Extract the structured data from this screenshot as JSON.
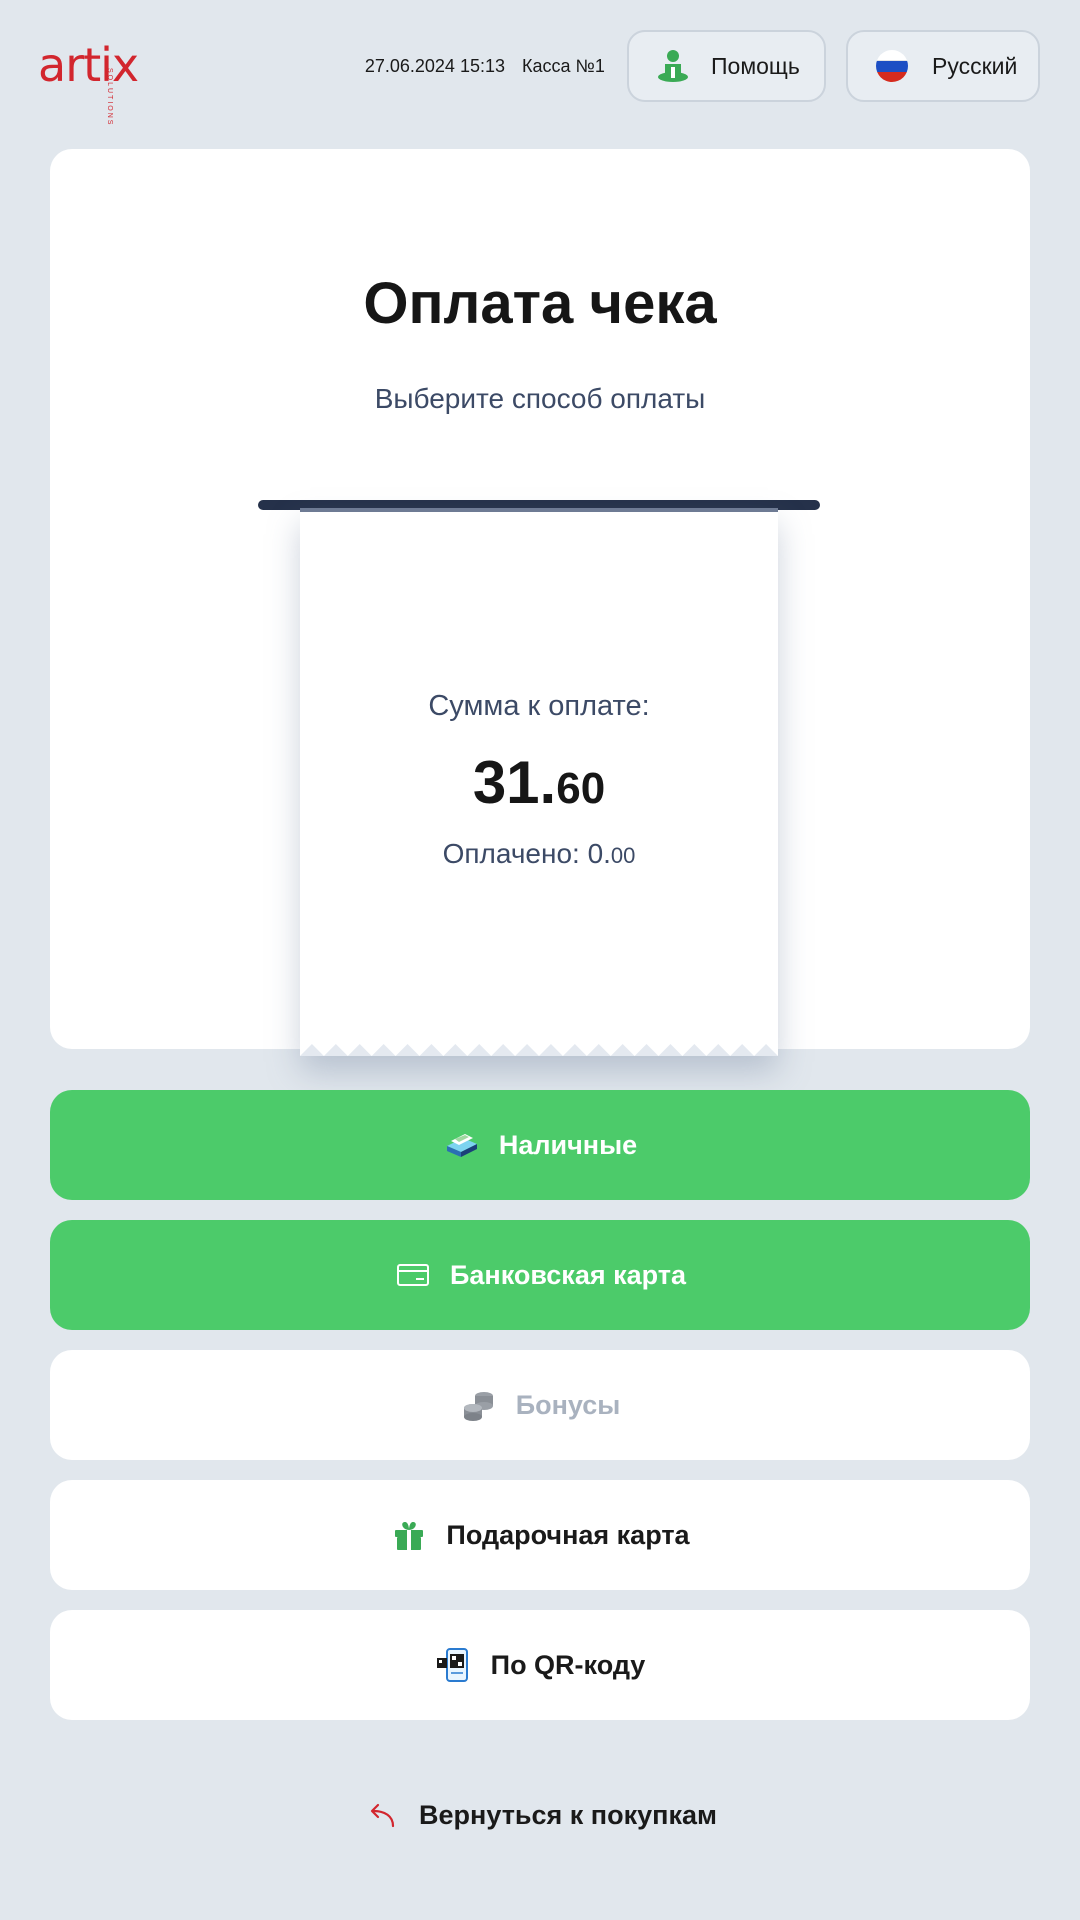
{
  "header": {
    "logo_text": "artix",
    "logo_sub": "SOLUTIONS",
    "datetime": "27.06.2024 15:13",
    "register": "Касса №1",
    "help_label": "Помощь",
    "help_icon": "person-help-icon",
    "language_label": "Русский",
    "language_icon": "russian-flag-icon"
  },
  "card": {
    "title": "Оплата чека",
    "subtitle": "Выберите способ оплаты"
  },
  "receipt": {
    "sum_label": "Сумма к оплате:",
    "sum_integer": "31.",
    "sum_decimal": "60",
    "paid_label": "Оплачено: 0.",
    "paid_decimal": "00"
  },
  "payment_methods": [
    {
      "label": "Наличные",
      "icon": "cash-icon",
      "style": "green",
      "enabled": true
    },
    {
      "label": "Банковская карта",
      "icon": "bank-card-icon",
      "style": "green",
      "enabled": true
    },
    {
      "label": "Бонусы",
      "icon": "coins-icon",
      "style": "white",
      "enabled": false
    },
    {
      "label": "Подарочная карта",
      "icon": "gift-icon",
      "style": "white",
      "enabled": true
    },
    {
      "label": "По QR-коду",
      "icon": "qr-phone-icon",
      "style": "white",
      "enabled": true
    }
  ],
  "back": {
    "label": "Вернуться к покупкам",
    "icon": "back-arrow-icon"
  },
  "colors": {
    "background": "#e1e7ed",
    "brand_red": "#d2262e",
    "accent_green": "#4ccb6a",
    "text_muted": "#3c4a66",
    "disabled": "#a9b2bf"
  }
}
